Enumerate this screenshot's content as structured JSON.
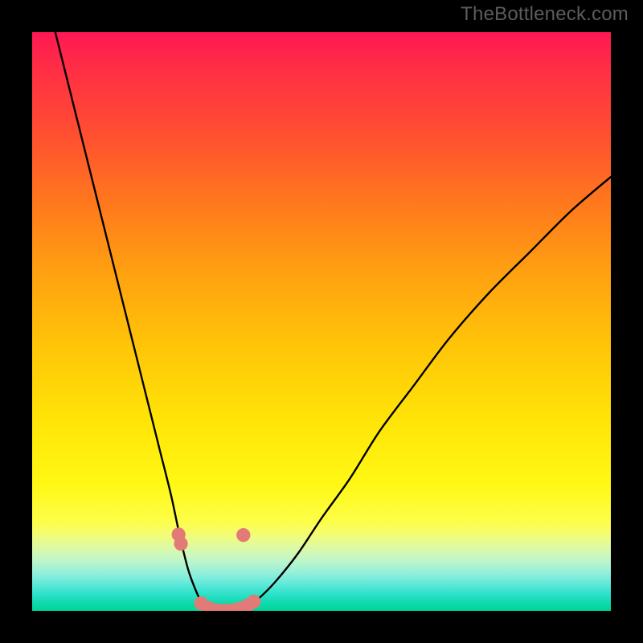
{
  "watermark": "TheBottleneck.com",
  "colors": {
    "frame_background": "#000000",
    "watermark_text": "#5c5c5c",
    "curve_stroke": "#000000",
    "marker_fill": "#e27b78",
    "gradient_top": "#ff1854",
    "gradient_bottom": "#00d695"
  },
  "chart_data": {
    "type": "line",
    "title": "",
    "xlabel": "",
    "ylabel": "",
    "xlim": [
      0,
      100
    ],
    "ylim": [
      0,
      100
    ],
    "background": "vertical-gradient red→orange→yellow→green (bottleneck heatmap)",
    "curves": [
      {
        "name": "left-branch",
        "x": [
          4,
          6,
          8,
          10,
          12,
          14,
          16,
          18,
          20,
          22,
          24,
          25.5,
          27,
          28.5,
          29.5,
          30
        ],
        "y": [
          100,
          92,
          84,
          76,
          68,
          60,
          52,
          44,
          36,
          28,
          20,
          13,
          7,
          3,
          1,
          0.4
        ]
      },
      {
        "name": "valley-floor",
        "x": [
          30,
          31,
          32,
          33,
          34,
          35,
          36,
          37
        ],
        "y": [
          0.4,
          0.1,
          0.0,
          0.0,
          0.0,
          0.1,
          0.3,
          0.6
        ]
      },
      {
        "name": "right-branch",
        "x": [
          37,
          39,
          42,
          46,
          50,
          55,
          60,
          66,
          72,
          79,
          86,
          93,
          100
        ],
        "y": [
          0.6,
          2,
          5,
          10,
          16,
          23,
          31,
          39,
          47,
          55,
          62,
          69,
          75
        ]
      }
    ],
    "markers": [
      {
        "x": 25.3,
        "y": 13.2,
        "r": 1.2
      },
      {
        "x": 25.7,
        "y": 11.6,
        "r": 1.2
      },
      {
        "x": 29.2,
        "y": 1.3,
        "r": 1.2
      },
      {
        "x": 30.5,
        "y": 0.5,
        "r": 1.2
      },
      {
        "x": 32.0,
        "y": 0.1,
        "r": 1.2
      },
      {
        "x": 33.4,
        "y": 0.05,
        "r": 1.2
      },
      {
        "x": 34.8,
        "y": 0.15,
        "r": 1.2
      },
      {
        "x": 36.1,
        "y": 0.45,
        "r": 1.2
      },
      {
        "x": 37.3,
        "y": 0.95,
        "r": 1.2
      },
      {
        "x": 38.3,
        "y": 1.6,
        "r": 1.2
      },
      {
        "x": 36.5,
        "y": 13.1,
        "r": 1.2
      }
    ],
    "note": "Axes unlabeled in source image. x/y on relative 0–100 scale inferred from plot extent. Curve is a steep asymmetric V; left branch near-vertical descent to ~x=30, flat valley floor ~x=30–37, right branch rises with decreasing slope to ~y=75 at x=100."
  }
}
